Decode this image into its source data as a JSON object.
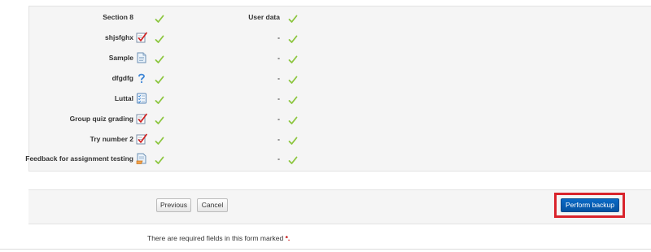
{
  "settings": {
    "header": {
      "label": "Section 8",
      "userdata_label": "User data"
    },
    "items": [
      {
        "label": "shjsfghx",
        "icon": "quiz-icon",
        "userdata": "-"
      },
      {
        "label": "Sample",
        "icon": "page-icon",
        "userdata": "-"
      },
      {
        "label": "dfgdfg",
        "icon": "question-icon",
        "userdata": "-"
      },
      {
        "label": "Luttal",
        "icon": "checklist-icon",
        "userdata": "-"
      },
      {
        "label": "Group quiz grading",
        "icon": "quiz-icon",
        "userdata": "-"
      },
      {
        "label": "Try number 2",
        "icon": "quiz-icon",
        "userdata": "-"
      },
      {
        "label": "Feedback for assignment testing",
        "icon": "assignment-icon",
        "userdata": "-"
      }
    ]
  },
  "buttons": {
    "previous": "Previous",
    "cancel": "Cancel",
    "perform_backup": "Perform backup"
  },
  "footer": {
    "required_note": "There are required fields in this form marked",
    "required_marker": "*."
  },
  "colors": {
    "check": "#8cc63f",
    "primary": "#0a5ea8",
    "highlight": "#d9242c"
  }
}
